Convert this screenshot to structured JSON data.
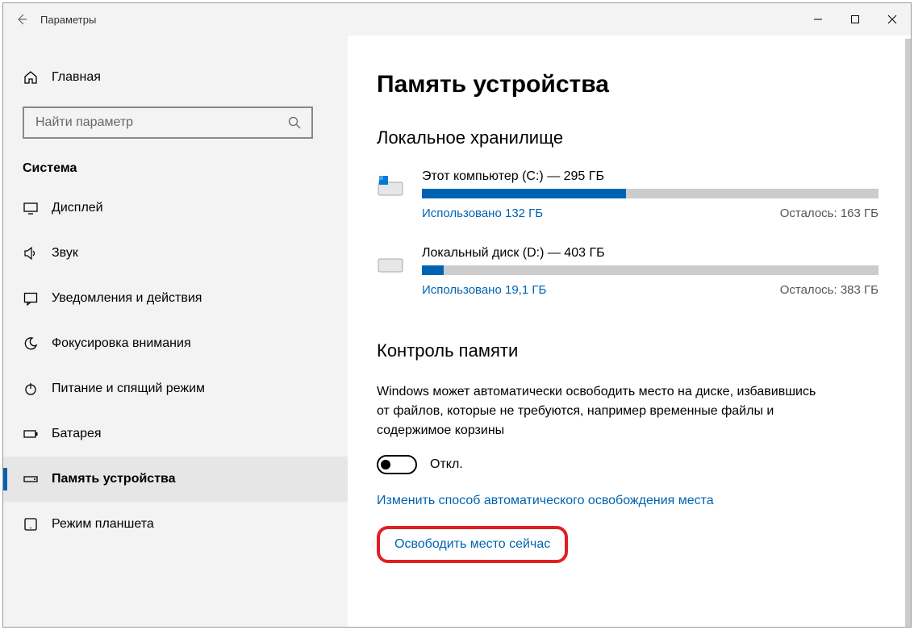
{
  "titlebar": {
    "back": "←",
    "title": "Параметры"
  },
  "sidebar": {
    "home": "Главная",
    "search_placeholder": "Найти параметр",
    "category": "Система",
    "items": [
      {
        "label": "Дисплей"
      },
      {
        "label": "Звук"
      },
      {
        "label": "Уведомления и действия"
      },
      {
        "label": "Фокусировка внимания"
      },
      {
        "label": "Питание и спящий режим"
      },
      {
        "label": "Батарея"
      },
      {
        "label": "Память устройства"
      },
      {
        "label": "Режим планшета"
      }
    ]
  },
  "main": {
    "heading": "Память устройства",
    "section1": "Локальное хранилище",
    "drives": [
      {
        "title": "Этот компьютер (C:) — 295 ГБ",
        "used": "Использовано 132 ГБ",
        "remain": "Осталось: 163 ГБ",
        "pct": 44.7
      },
      {
        "title": "Локальный диск (D:) — 403 ГБ",
        "used": "Использовано 19,1 ГБ",
        "remain": "Осталось: 383 ГБ",
        "pct": 4.7
      }
    ],
    "section2": "Контроль памяти",
    "desc": "Windows может автоматически освободить место на диске, избавившись от файлов, которые не требуются, например временные файлы и содержимое корзины",
    "toggle_state": "Откл.",
    "link1": "Изменить способ автоматического освобождения места",
    "link2": "Освободить место сейчас"
  }
}
